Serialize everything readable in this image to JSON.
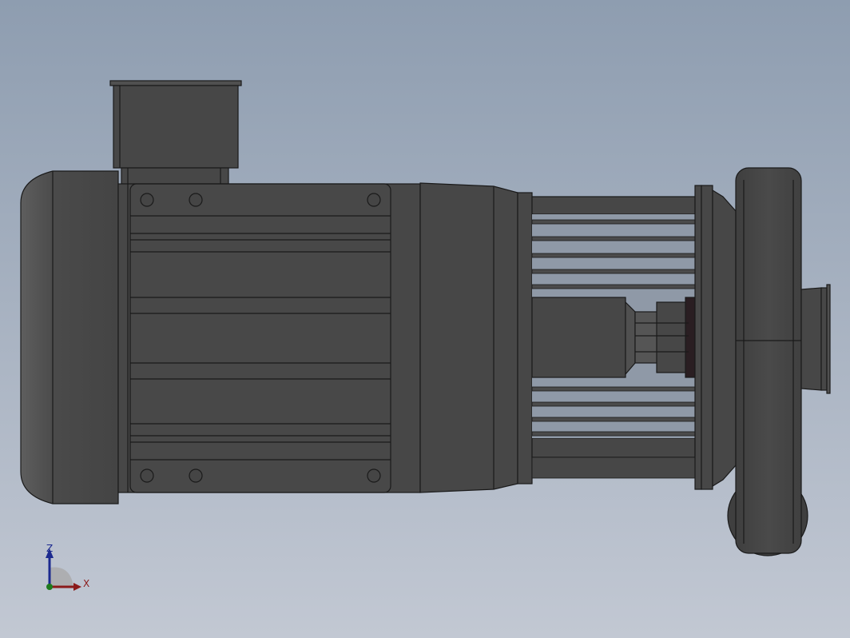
{
  "viewport": {
    "background_top": "#8e9db0",
    "background_bottom": "#c2c8d3"
  },
  "model": {
    "body_color": "#474747",
    "edge_color": "#1a1a1a",
    "highlight_color": "#5a5a5a"
  },
  "triad": {
    "z_label": "Z",
    "x_label": "X",
    "z_color": "#1c2a8f",
    "x_color": "#8b1a1a",
    "y_color": "#1e7a1e"
  }
}
